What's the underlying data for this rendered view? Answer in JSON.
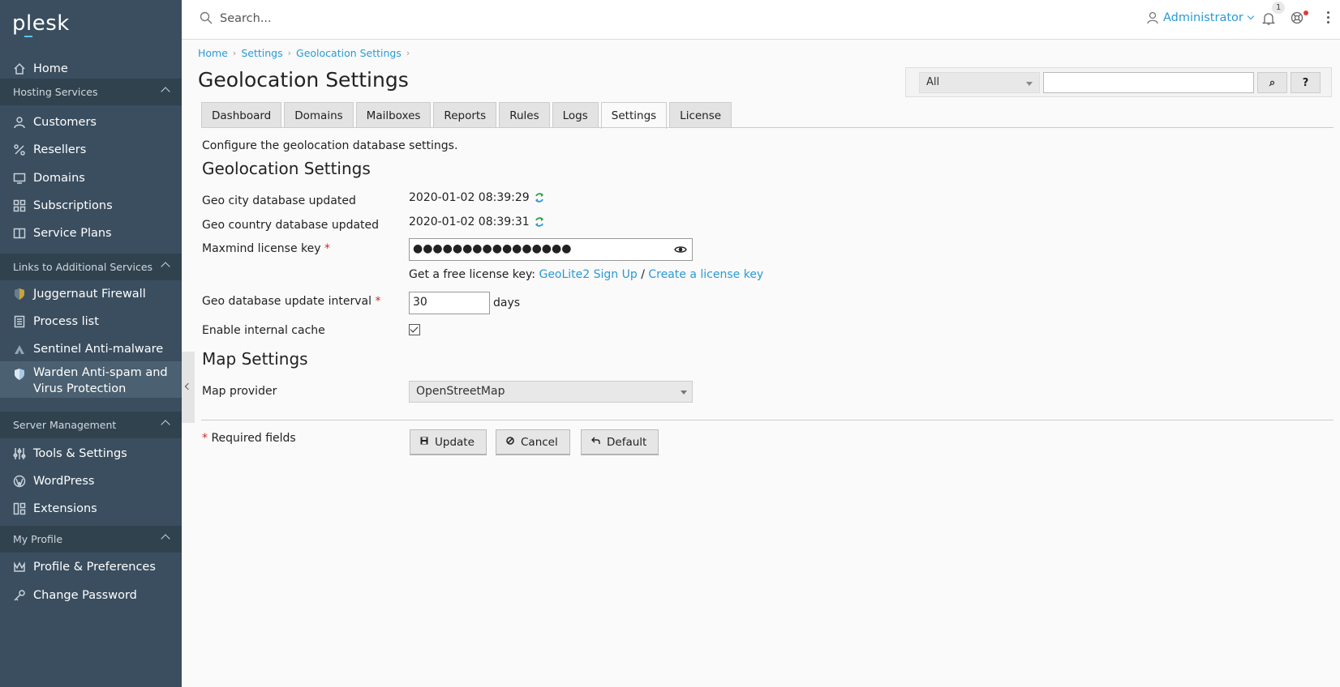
{
  "app": {
    "logo": "plesk"
  },
  "sidebar": {
    "home": "Home",
    "sections": [
      {
        "label": "Hosting Services"
      },
      {
        "label": "Links to Additional Services"
      },
      {
        "label": "Server Management"
      },
      {
        "label": "My Profile"
      }
    ],
    "items": {
      "customers": "Customers",
      "resellers": "Resellers",
      "domains": "Domains",
      "subscriptions": "Subscriptions",
      "service_plans": "Service Plans",
      "juggernaut": "Juggernaut Firewall",
      "process_list": "Process list",
      "sentinel": "Sentinel Anti-malware",
      "warden_1": "Warden Anti-spam and",
      "warden_2": "Virus Protection",
      "tools": "Tools & Settings",
      "wordpress": "WordPress",
      "extensions": "Extensions",
      "profile": "Profile & Preferences",
      "change_password": "Change Password"
    }
  },
  "topbar": {
    "search_placeholder": "Search...",
    "user": "Administrator",
    "notifications_count": "1"
  },
  "breadcrumb": [
    "Home",
    "Settings",
    "Geolocation Settings"
  ],
  "page": {
    "title": "Geolocation Settings",
    "search_filter": "All",
    "search_button": "⌕",
    "help_button": "?"
  },
  "tabs": [
    "Dashboard",
    "Domains",
    "Mailboxes",
    "Reports",
    "Rules",
    "Logs",
    "Settings",
    "License"
  ],
  "active_tab": "Settings",
  "form": {
    "description": "Configure the geolocation database settings.",
    "section_geo": "Geolocation Settings",
    "geo_city_label": "Geo city database updated",
    "geo_city_value": "2020-01-02 08:39:29",
    "geo_country_label": "Geo country database updated",
    "geo_country_value": "2020-01-02 08:39:31",
    "license_key_label": "Maxmind license key",
    "license_key_value": "●●●●●●●●●●●●●●●●",
    "hint_text": "Get a free license key:",
    "hint_link1": "GeoLite2 Sign Up",
    "hint_sep": "/",
    "hint_link2": "Create a license key",
    "interval_label": "Geo database update interval",
    "interval_value": "30",
    "interval_unit": "days",
    "cache_label": "Enable internal cache",
    "cache_checked": true,
    "section_map": "Map Settings",
    "map_provider_label": "Map provider",
    "map_provider_value": "OpenStreetMap",
    "required_star": "*",
    "required_text": "Required fields"
  },
  "buttons": {
    "update": "Update",
    "cancel": "Cancel",
    "default": "Default"
  },
  "colors": {
    "sidebar_bg": "#3a4e5f",
    "link": "#2a9ad6",
    "required": "#d02a2a"
  }
}
